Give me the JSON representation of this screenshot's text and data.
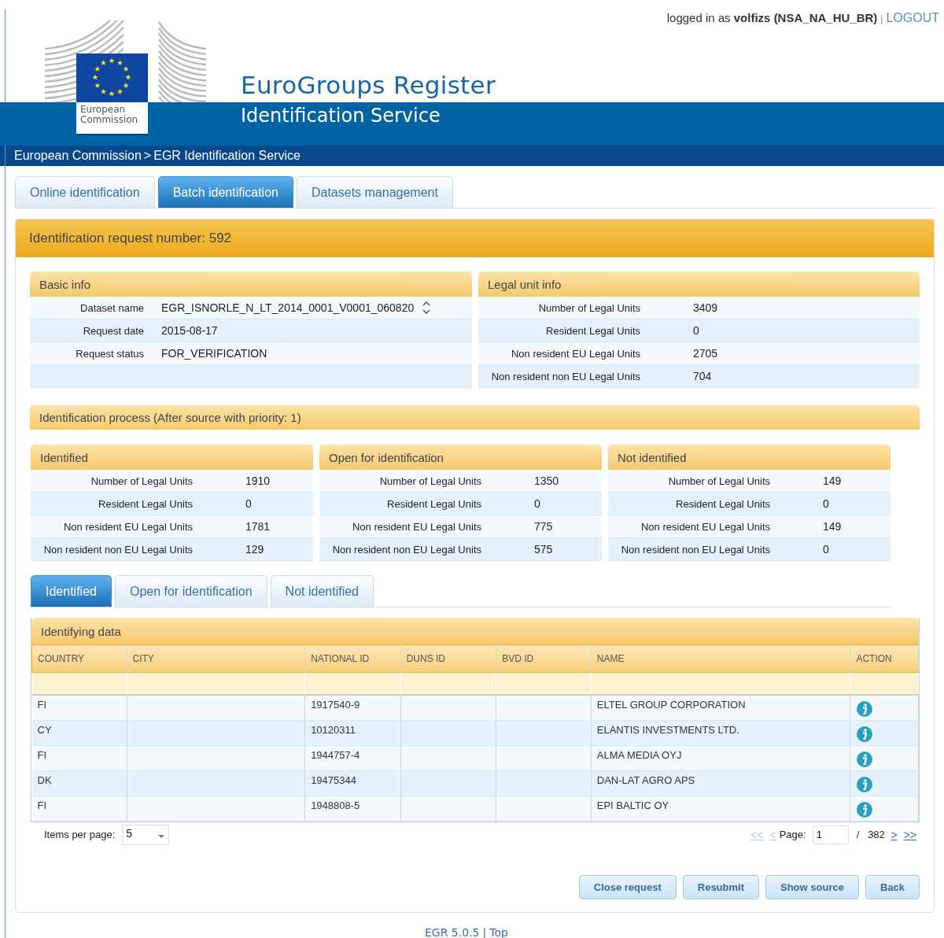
{
  "header": {
    "user_prefix": "logged in as",
    "user": "volfizs (NSA_NA_HU_BR)",
    "separator": "|",
    "logout": "LOGOUT",
    "logo_lines": [
      "European",
      "Commission"
    ],
    "title": "EuroGroups Register",
    "subtitle": "Identification Service"
  },
  "breadcrumb": {
    "separator": ">",
    "items": [
      "European Commission",
      "EGR Identification Service"
    ]
  },
  "tabs": [
    {
      "label": "Online identification",
      "selected": false
    },
    {
      "label": "Batch identification",
      "selected": true
    },
    {
      "label": "Datasets management",
      "selected": false
    }
  ],
  "request_title": "Identification request number: 592",
  "basic_info": {
    "title": "Basic info",
    "rows": [
      {
        "label": "Dataset name",
        "value": "EGR_ISNORLE_N_LT_2014_0001_V0001_060820",
        "kind": "scroll"
      },
      {
        "label": "Request date",
        "value": "2015-08-17",
        "kind": "plain"
      },
      {
        "label": "Request status",
        "value": "FOR_VERIFICATION",
        "kind": "plain"
      }
    ]
  },
  "legal_unit_info": {
    "title": "Legal unit info",
    "rows": [
      {
        "label": "Number of Legal Units",
        "value": "3409"
      },
      {
        "label": "Resident Legal Units",
        "value": "0"
      },
      {
        "label": "Non resident EU Legal Units",
        "value": "2705"
      },
      {
        "label": "Non resident non EU Legal Units",
        "value": "704"
      }
    ]
  },
  "process": {
    "title": "Identification process (After source with priority: 1)",
    "groups": [
      {
        "title": "Identified",
        "rows": [
          {
            "label": "Number of Legal Units",
            "value": "1910"
          },
          {
            "label": "Resident Legal Units",
            "value": "0"
          },
          {
            "label": "Non resident EU Legal Units",
            "value": "1781"
          },
          {
            "label": "Non resident non EU Legal Units",
            "value": "129"
          }
        ]
      },
      {
        "title": "Open for identification",
        "rows": [
          {
            "label": "Number of Legal Units",
            "value": "1350"
          },
          {
            "label": "Resident Legal Units",
            "value": "0"
          },
          {
            "label": "Non resident EU Legal Units",
            "value": "775"
          },
          {
            "label": "Non resident non EU Legal Units",
            "value": "575"
          }
        ]
      },
      {
        "title": "Not identified",
        "rows": [
          {
            "label": "Number of Legal Units",
            "value": "149"
          },
          {
            "label": "Resident Legal Units",
            "value": "0"
          },
          {
            "label": "Non resident EU Legal Units",
            "value": "149"
          },
          {
            "label": "Non resident non EU Legal Units",
            "value": "0"
          }
        ]
      }
    ]
  },
  "result_tabs": [
    {
      "label": "Identified",
      "selected": true
    },
    {
      "label": "Open for identification",
      "selected": false
    },
    {
      "label": "Not identified",
      "selected": false
    }
  ],
  "table": {
    "title": "Identifying data",
    "columns": [
      "COUNTRY",
      "CITY",
      "NATIONAL ID",
      "DUNS ID",
      "BVD ID",
      "NAME",
      "ACTION"
    ],
    "rows": [
      {
        "country": "FI",
        "national_id": "1917540-9",
        "name": "ELTEL GROUP CORPORATION"
      },
      {
        "country": "CY",
        "national_id": "10120311",
        "name": "ELANTIS INVESTMENTS LTD."
      },
      {
        "country": "FI",
        "national_id": "1944757-4",
        "name": "ALMA MEDIA OYJ"
      },
      {
        "country": "DK",
        "national_id": "19475344",
        "name": "DAN-LAT AGRO APS"
      },
      {
        "country": "FI",
        "national_id": "1948808-5",
        "name": "EPI BALTIC OY"
      }
    ]
  },
  "pagination": {
    "items_label": "Items per page:",
    "items_value": "5",
    "nav_back": [
      {
        "label": "<<",
        "disabled": true
      },
      {
        "label": "<",
        "disabled": true
      }
    ],
    "page_label": "Page:",
    "page_value": "1",
    "of": "/",
    "total": "382",
    "nav_forward": [
      {
        "label": ">",
        "disabled": false
      },
      {
        "label": ">>",
        "disabled": false
      }
    ]
  },
  "buttons": [
    "Close request",
    "Resubmit",
    "Show source",
    "Back"
  ],
  "footer": {
    "version": "EGR 5.0.5",
    "separator": "|",
    "link": "Top"
  }
}
